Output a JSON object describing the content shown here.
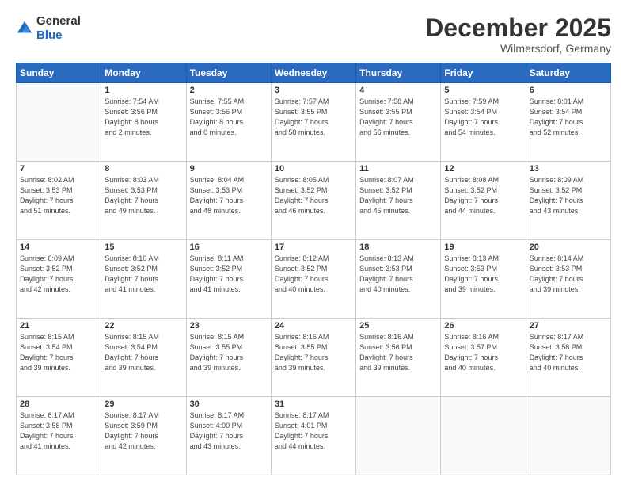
{
  "header": {
    "logo": {
      "general": "General",
      "blue": "Blue"
    },
    "title": "December 2025",
    "location": "Wilmersdorf, Germany"
  },
  "weekdays": [
    "Sunday",
    "Monday",
    "Tuesday",
    "Wednesday",
    "Thursday",
    "Friday",
    "Saturday"
  ],
  "weeks": [
    [
      {
        "day": "",
        "info": ""
      },
      {
        "day": "1",
        "info": "Sunrise: 7:54 AM\nSunset: 3:56 PM\nDaylight: 8 hours\nand 2 minutes."
      },
      {
        "day": "2",
        "info": "Sunrise: 7:55 AM\nSunset: 3:56 PM\nDaylight: 8 hours\nand 0 minutes."
      },
      {
        "day": "3",
        "info": "Sunrise: 7:57 AM\nSunset: 3:55 PM\nDaylight: 7 hours\nand 58 minutes."
      },
      {
        "day": "4",
        "info": "Sunrise: 7:58 AM\nSunset: 3:55 PM\nDaylight: 7 hours\nand 56 minutes."
      },
      {
        "day": "5",
        "info": "Sunrise: 7:59 AM\nSunset: 3:54 PM\nDaylight: 7 hours\nand 54 minutes."
      },
      {
        "day": "6",
        "info": "Sunrise: 8:01 AM\nSunset: 3:54 PM\nDaylight: 7 hours\nand 52 minutes."
      }
    ],
    [
      {
        "day": "7",
        "info": "Sunrise: 8:02 AM\nSunset: 3:53 PM\nDaylight: 7 hours\nand 51 minutes."
      },
      {
        "day": "8",
        "info": "Sunrise: 8:03 AM\nSunset: 3:53 PM\nDaylight: 7 hours\nand 49 minutes."
      },
      {
        "day": "9",
        "info": "Sunrise: 8:04 AM\nSunset: 3:53 PM\nDaylight: 7 hours\nand 48 minutes."
      },
      {
        "day": "10",
        "info": "Sunrise: 8:05 AM\nSunset: 3:52 PM\nDaylight: 7 hours\nand 46 minutes."
      },
      {
        "day": "11",
        "info": "Sunrise: 8:07 AM\nSunset: 3:52 PM\nDaylight: 7 hours\nand 45 minutes."
      },
      {
        "day": "12",
        "info": "Sunrise: 8:08 AM\nSunset: 3:52 PM\nDaylight: 7 hours\nand 44 minutes."
      },
      {
        "day": "13",
        "info": "Sunrise: 8:09 AM\nSunset: 3:52 PM\nDaylight: 7 hours\nand 43 minutes."
      }
    ],
    [
      {
        "day": "14",
        "info": "Sunrise: 8:09 AM\nSunset: 3:52 PM\nDaylight: 7 hours\nand 42 minutes."
      },
      {
        "day": "15",
        "info": "Sunrise: 8:10 AM\nSunset: 3:52 PM\nDaylight: 7 hours\nand 41 minutes."
      },
      {
        "day": "16",
        "info": "Sunrise: 8:11 AM\nSunset: 3:52 PM\nDaylight: 7 hours\nand 41 minutes."
      },
      {
        "day": "17",
        "info": "Sunrise: 8:12 AM\nSunset: 3:52 PM\nDaylight: 7 hours\nand 40 minutes."
      },
      {
        "day": "18",
        "info": "Sunrise: 8:13 AM\nSunset: 3:53 PM\nDaylight: 7 hours\nand 40 minutes."
      },
      {
        "day": "19",
        "info": "Sunrise: 8:13 AM\nSunset: 3:53 PM\nDaylight: 7 hours\nand 39 minutes."
      },
      {
        "day": "20",
        "info": "Sunrise: 8:14 AM\nSunset: 3:53 PM\nDaylight: 7 hours\nand 39 minutes."
      }
    ],
    [
      {
        "day": "21",
        "info": "Sunrise: 8:15 AM\nSunset: 3:54 PM\nDaylight: 7 hours\nand 39 minutes."
      },
      {
        "day": "22",
        "info": "Sunrise: 8:15 AM\nSunset: 3:54 PM\nDaylight: 7 hours\nand 39 minutes."
      },
      {
        "day": "23",
        "info": "Sunrise: 8:15 AM\nSunset: 3:55 PM\nDaylight: 7 hours\nand 39 minutes."
      },
      {
        "day": "24",
        "info": "Sunrise: 8:16 AM\nSunset: 3:55 PM\nDaylight: 7 hours\nand 39 minutes."
      },
      {
        "day": "25",
        "info": "Sunrise: 8:16 AM\nSunset: 3:56 PM\nDaylight: 7 hours\nand 39 minutes."
      },
      {
        "day": "26",
        "info": "Sunrise: 8:16 AM\nSunset: 3:57 PM\nDaylight: 7 hours\nand 40 minutes."
      },
      {
        "day": "27",
        "info": "Sunrise: 8:17 AM\nSunset: 3:58 PM\nDaylight: 7 hours\nand 40 minutes."
      }
    ],
    [
      {
        "day": "28",
        "info": "Sunrise: 8:17 AM\nSunset: 3:58 PM\nDaylight: 7 hours\nand 41 minutes."
      },
      {
        "day": "29",
        "info": "Sunrise: 8:17 AM\nSunset: 3:59 PM\nDaylight: 7 hours\nand 42 minutes."
      },
      {
        "day": "30",
        "info": "Sunrise: 8:17 AM\nSunset: 4:00 PM\nDaylight: 7 hours\nand 43 minutes."
      },
      {
        "day": "31",
        "info": "Sunrise: 8:17 AM\nSunset: 4:01 PM\nDaylight: 7 hours\nand 44 minutes."
      },
      {
        "day": "",
        "info": ""
      },
      {
        "day": "",
        "info": ""
      },
      {
        "day": "",
        "info": ""
      }
    ]
  ]
}
